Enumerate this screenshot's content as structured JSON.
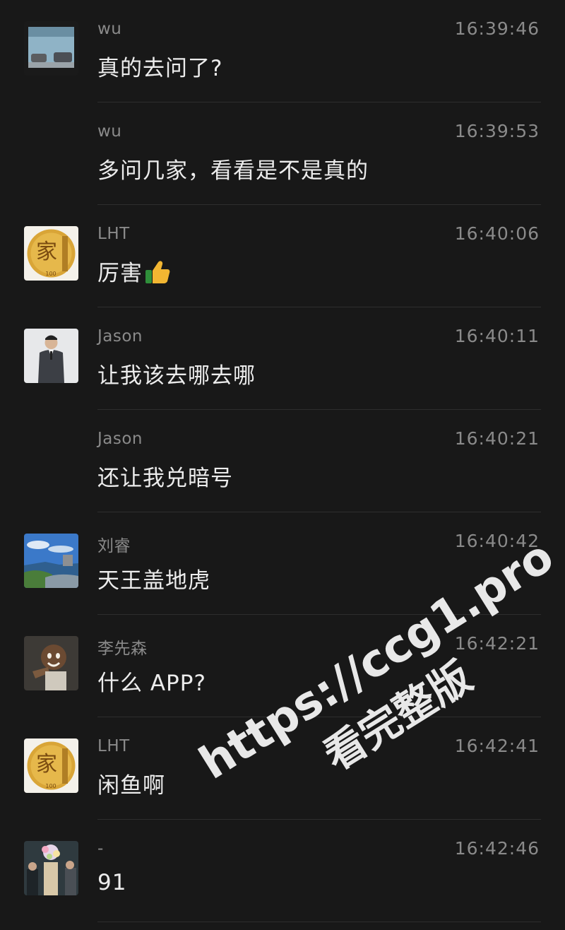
{
  "messages": [
    {
      "sender": "wu",
      "time": "16:39:46",
      "text": "真的去问了?",
      "avatar": "car-photo-avatar"
    },
    {
      "sender": "wu",
      "time": "16:39:53",
      "text": "多问几家，看看是不是真的",
      "avatar": ""
    },
    {
      "sender": "LHT",
      "time": "16:40:06",
      "text": "厉害",
      "emoji": "thumbs-up-icon",
      "avatar": "coin-avatar"
    },
    {
      "sender": "Jason",
      "time": "16:40:11",
      "text": "让我该去哪去哪",
      "avatar": "suit-man-avatar"
    },
    {
      "sender": "Jason",
      "time": "16:40:21",
      "text": "还让我兑暗号",
      "avatar": ""
    },
    {
      "sender": "刘睿",
      "time": "16:40:42",
      "text": "天王盖地虎",
      "avatar": "coast-landscape-avatar"
    },
    {
      "sender": "李先森",
      "time": "16:42:21",
      "text": "什么 APP?",
      "avatar": "child-photo-avatar"
    },
    {
      "sender": "LHT",
      "time": "16:42:41",
      "text": "闲鱼啊",
      "avatar": "coin-avatar"
    },
    {
      "sender": "-",
      "time": "16:42:46",
      "text": "91",
      "avatar": "flowers-crowd-avatar"
    }
  ],
  "watermark": {
    "url": "https://ccg1.pro",
    "caption": "看完整版"
  },
  "colors": {
    "background": "#181818",
    "meta_text": "#8a8a8a",
    "message_text": "#ececec",
    "divider": "#2e2e2e"
  }
}
